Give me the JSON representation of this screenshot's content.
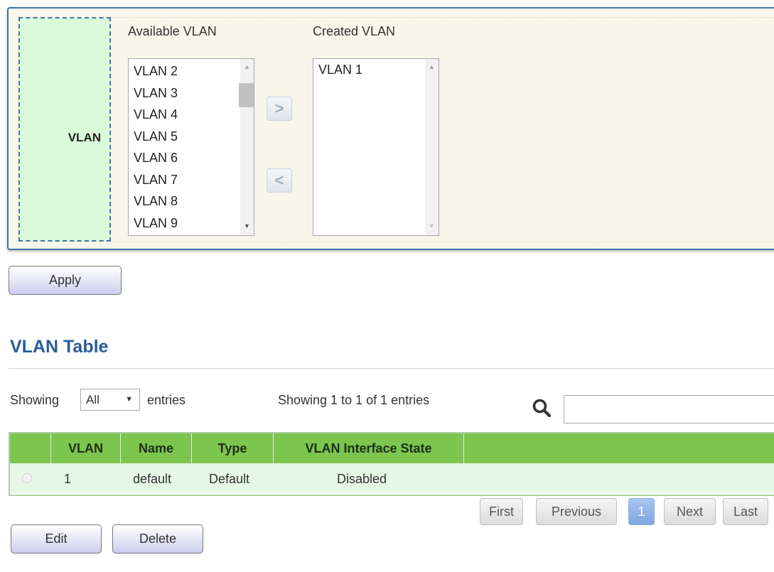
{
  "vlan_config": {
    "field_label": "VLAN",
    "available_caption": "Available VLAN",
    "created_caption": "Created VLAN",
    "available_items": [
      "VLAN 2",
      "VLAN 3",
      "VLAN 4",
      "VLAN 5",
      "VLAN 6",
      "VLAN 7",
      "VLAN 8",
      "VLAN 9"
    ],
    "created_items": [
      "VLAN 1"
    ],
    "move_right_glyph": ">",
    "move_left_glyph": "<"
  },
  "apply_label": "Apply",
  "vlan_table": {
    "title": "VLAN Table",
    "showing_prefix": "Showing",
    "entries_select_value": "All",
    "showing_suffix": "entries",
    "info": "Showing 1 to 1 of 1 entries",
    "search_placeholder": "",
    "columns": [
      "VLAN",
      "Name",
      "Type",
      "VLAN Interface State"
    ],
    "rows": [
      {
        "vlan": "1",
        "name": "default",
        "type": "Default",
        "state": "Disabled"
      }
    ],
    "pagination": {
      "first": "First",
      "previous": "Previous",
      "current_page": "1",
      "next": "Next",
      "last": "Last"
    }
  },
  "actions": {
    "edit": "Edit",
    "delete": "Delete"
  },
  "colors": {
    "panel_border": "#3e73ad",
    "label_cell_bg": "#d9fbd9",
    "table_header_bg": "#7cc54e",
    "row_bg": "#e6f7e6",
    "title_color": "#2a5d95"
  }
}
